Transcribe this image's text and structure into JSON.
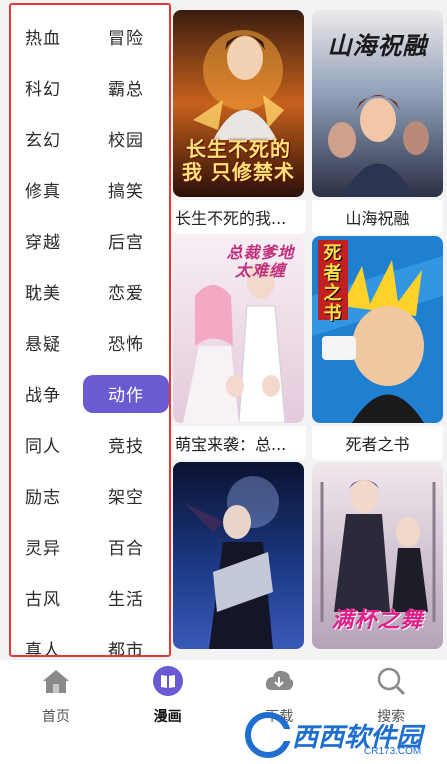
{
  "categories": [
    {
      "label": "热血"
    },
    {
      "label": "冒险"
    },
    {
      "label": "科幻"
    },
    {
      "label": "霸总"
    },
    {
      "label": "玄幻"
    },
    {
      "label": "校园"
    },
    {
      "label": "修真"
    },
    {
      "label": "搞笑"
    },
    {
      "label": "穿越"
    },
    {
      "label": "后宫"
    },
    {
      "label": "耽美"
    },
    {
      "label": "恋爱"
    },
    {
      "label": "悬疑"
    },
    {
      "label": "恐怖"
    },
    {
      "label": "战争"
    },
    {
      "label": "动作"
    },
    {
      "label": "同人"
    },
    {
      "label": "竞技"
    },
    {
      "label": "励志"
    },
    {
      "label": "架空"
    },
    {
      "label": "灵异"
    },
    {
      "label": "百合"
    },
    {
      "label": "古风"
    },
    {
      "label": "生活"
    },
    {
      "label": "真人"
    },
    {
      "label": "都市"
    }
  ],
  "active_category": "动作",
  "comics": [
    {
      "title": "长生不死的我...",
      "cover_text": "长生不死的我 只修禁术"
    },
    {
      "title": "山海祝融",
      "cover_text": "山海祝融"
    },
    {
      "title": "萌宝来袭：总...",
      "cover_text": "总裁爹地 太难缠"
    },
    {
      "title": "死者之书",
      "cover_text": "死者之书"
    },
    {
      "title": "",
      "cover_text": ""
    },
    {
      "title": "",
      "cover_text": "满杯之舞"
    }
  ],
  "nav": [
    {
      "label": "首页",
      "icon": "home-icon"
    },
    {
      "label": "漫画",
      "icon": "book-icon"
    },
    {
      "label": "下载",
      "icon": "download-icon"
    },
    {
      "label": "搜索",
      "icon": "search-icon"
    }
  ],
  "watermark": {
    "text": "西西软件园",
    "sub": "CR173.COM"
  },
  "colors": {
    "accent": "#6b5bd2",
    "highlight_border": "#e53935"
  }
}
